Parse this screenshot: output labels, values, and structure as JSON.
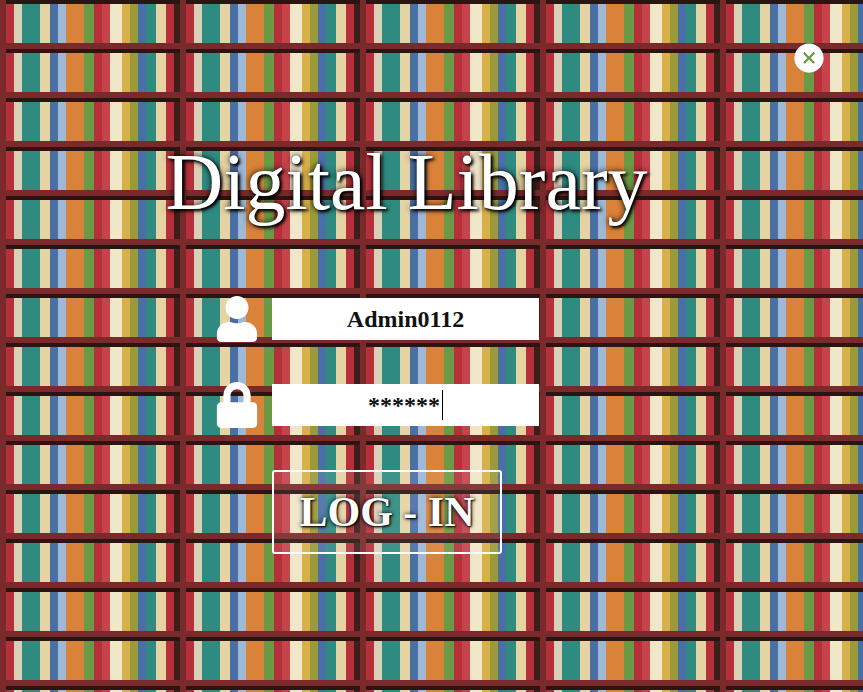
{
  "window": {
    "title": "Digital Library"
  },
  "fields": [
    {
      "kind": "username",
      "value": "Admin0112",
      "focused": false
    },
    {
      "kind": "password",
      "value": "******",
      "focused": true
    }
  ],
  "buttons": [
    "LOG - IN"
  ]
}
